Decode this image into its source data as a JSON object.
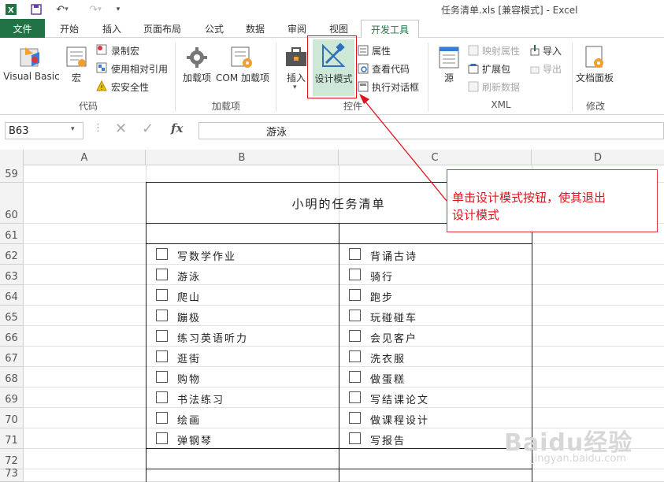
{
  "window": {
    "title": "任务清单.xls  [兼容模式] - Excel",
    "quick_access": [
      "excel-logo-icon",
      "save-icon",
      "undo-icon",
      "redo-icon",
      "customize-icon"
    ]
  },
  "tabs": {
    "file": "文件",
    "home": "开始",
    "insert": "插入",
    "layout": "页面布局",
    "formulas": "公式",
    "data": "数据",
    "review": "审阅",
    "view": "视图",
    "developer": "开发工具"
  },
  "ribbon": {
    "code": {
      "visual_basic": "Visual Basic",
      "macros": "宏",
      "record_macro": "录制宏",
      "relative_ref": "使用相对引用",
      "macro_security": "宏安全性",
      "label": "代码"
    },
    "addins": {
      "addins": "加载项",
      "com_addins": "COM 加载项",
      "label": "加载项"
    },
    "controls": {
      "insert": "插入",
      "design_mode": "设计模式",
      "properties": "属性",
      "view_code": "查看代码",
      "run_dialog": "执行对话框",
      "label": "控件"
    },
    "xml": {
      "source": "源",
      "map_properties": "映射属性",
      "expansion_packs": "扩展包",
      "refresh_data": "刷新数据",
      "import": "导入",
      "export": "导出",
      "label": "XML"
    },
    "modify": {
      "document_panel": "文档面板",
      "label": "修改"
    }
  },
  "formula_bar": {
    "name_box": "B63",
    "fx": "fx",
    "value": "游泳"
  },
  "sheet": {
    "columns": [
      "A",
      "B",
      "C",
      "D"
    ],
    "rows": [
      "59",
      "60",
      "61",
      "62",
      "63",
      "64",
      "65",
      "66",
      "67",
      "68",
      "69",
      "70",
      "71",
      "72",
      "73"
    ],
    "table_title": "小明的任务清单",
    "tasks_b": [
      "写数学作业",
      "游泳",
      "爬山",
      "蹦极",
      "练习英语听力",
      "逛街",
      "购物",
      "书法练习",
      "绘画",
      "弹钢琴"
    ],
    "tasks_c": [
      "背诵古诗",
      "骑行",
      "跑步",
      "玩碰碰车",
      "会见客户",
      "洗衣服",
      "做蛋糕",
      "写结课论文",
      "做课程设计",
      "写报告"
    ]
  },
  "callout": {
    "text_line1": "单击设计模式按钮，使其退出",
    "text_line2": "设计模式"
  },
  "watermark": {
    "text": "Baidu经验",
    "sub": "jingyan.baidu.com"
  },
  "colors": {
    "excel_green": "#217346",
    "callout_red": "#e0121b",
    "design_mode_bg": "#cde8d7"
  }
}
